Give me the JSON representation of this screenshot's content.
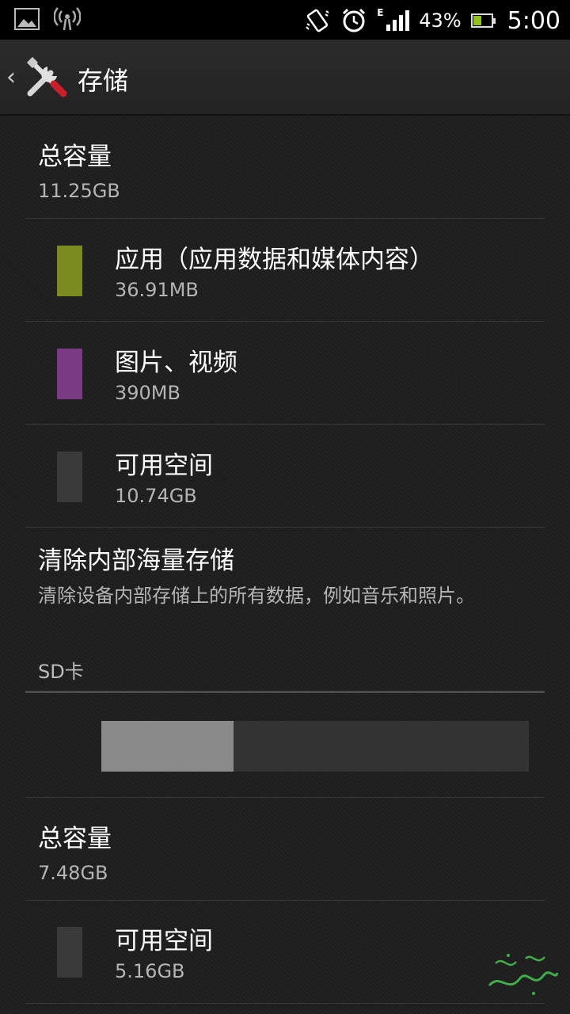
{
  "status_bar": {
    "battery_percent": "43%",
    "battery_level": 0.43,
    "time": "5:00",
    "network_type": "E",
    "icons": [
      "image-notification-icon",
      "wireless-hotspot-icon",
      "vibrate-icon",
      "alarm-icon",
      "signal-icon",
      "battery-icon"
    ]
  },
  "action_bar": {
    "title": "存储",
    "icon": "settings-tools-icon"
  },
  "internal": {
    "total_label": "总容量",
    "total_value": "11.25GB",
    "rows": [
      {
        "title": "应用（应用数据和媒体内容）",
        "value": "36.91MB",
        "color": "#7d8a20"
      },
      {
        "title": "图片、视频",
        "value": "390MB",
        "color": "#7a3a84"
      },
      {
        "title": "可用空间",
        "value": "10.74GB",
        "color": "#3a3a3a"
      }
    ],
    "erase_title": "清除内部海量存储",
    "erase_desc": "清除设备内部存储上的所有数据，例如音乐和照片。"
  },
  "sd_card": {
    "header": "SD卡",
    "used_fraction": 0.31,
    "used_color": "#8a8a8a",
    "total_label": "总容量",
    "total_value": "7.48GB",
    "rows": [
      {
        "title": "可用空间",
        "value": "5.16GB",
        "color": "#3a3a3a"
      }
    ]
  }
}
